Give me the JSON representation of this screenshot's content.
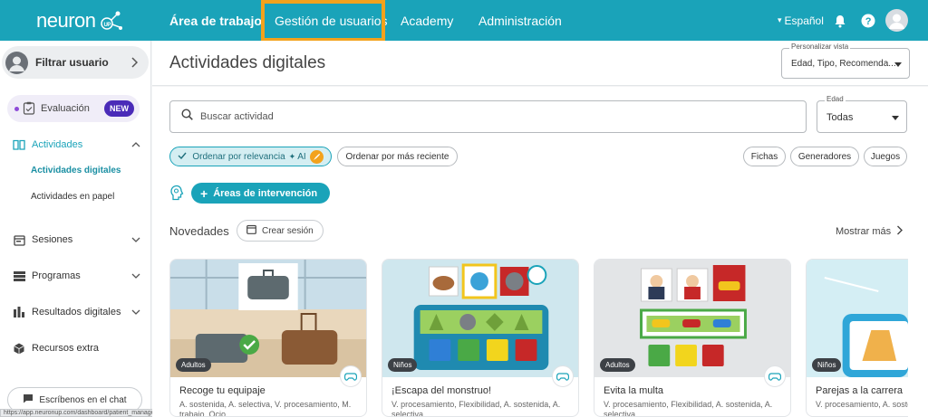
{
  "app": {
    "logo_text": "neuron",
    "logo_badge": "UP"
  },
  "topnav": {
    "items": [
      {
        "label": "Área de trabajo",
        "active": true
      },
      {
        "label": "Gestión de usuarios",
        "highlighted": true
      },
      {
        "label": "Academy"
      },
      {
        "label": "Administración"
      }
    ],
    "language": "Español",
    "language_caret": "▾",
    "icons": [
      "bell-icon",
      "help-icon",
      "user-avatar-icon"
    ]
  },
  "sidebar": {
    "filter_user": "Filtrar usuario",
    "evaluation": {
      "label": "Evaluación",
      "badge": "NEW"
    },
    "items": [
      {
        "label": "Actividades",
        "icon": "book-icon",
        "expanded": true
      },
      {
        "label": "Sesiones",
        "icon": "calendar-icon"
      },
      {
        "label": "Programas",
        "icon": "list-icon"
      },
      {
        "label": "Resultados digitales",
        "icon": "chart-icon"
      },
      {
        "label": "Recursos extra",
        "icon": "cube-icon"
      }
    ],
    "sub_items": [
      {
        "label": "Actividades digitales",
        "active": true
      },
      {
        "label": "Actividades en papel"
      }
    ],
    "chat_button": "Escríbenos en el chat",
    "url_tooltip": "https://app.neuronup.com/dashboard/patient_management"
  },
  "header": {
    "title": "Actividades digitales",
    "view_selector": {
      "legend": "Personalizar vista",
      "value": "Edad, Tipo, Recomenda..."
    }
  },
  "search": {
    "placeholder": "Buscar actividad"
  },
  "age_filter": {
    "legend": "Edad",
    "value": "Todas"
  },
  "sort_chips": {
    "relevance": "Ordenar por relevancia",
    "ai_label": "AI",
    "recent": "Ordenar por más reciente"
  },
  "type_chips": [
    "Fichas",
    "Generadores",
    "Juegos"
  ],
  "areas_button": "Áreas de intervención",
  "novedades": {
    "title": "Novedades",
    "create_session": "Crear sesión",
    "show_more": "Mostrar más"
  },
  "cards": [
    {
      "tag": "Adultos",
      "title": "Recoge tu equipaje",
      "desc": "A. sostenida, A. selectiva, V. procesamiento, M. trabajo, Ocio"
    },
    {
      "tag": "Niños",
      "title": "¡Escapa del monstruo!",
      "desc": "V. procesamiento, Flexibilidad, A. sostenida, A. selectiva"
    },
    {
      "tag": "Adultos",
      "title": "Evita la multa",
      "desc": "V. procesamiento, Flexibilidad, A. sostenida, A. selectiva"
    },
    {
      "tag": "Niños",
      "title": "Parejas a la carrera",
      "desc": "V. procesamiento, A. sostenida"
    }
  ],
  "colors": {
    "primary": "#1aa3b9",
    "highlight": "#f3a21c",
    "new_badge": "#4a2bb8"
  }
}
